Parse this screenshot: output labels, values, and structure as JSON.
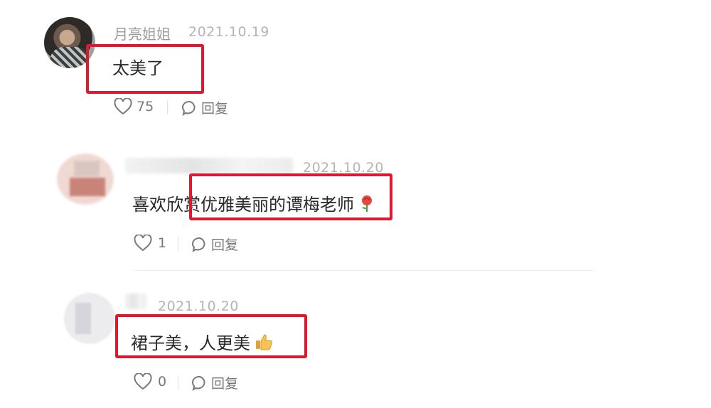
{
  "comments": [
    {
      "username": "月亮姐姐",
      "date": "2021.10.19",
      "text": "太美了",
      "likes": "75",
      "reply_label": "回复"
    },
    {
      "username": "",
      "date": "2021.10.20",
      "text": "喜欢欣赏优雅美丽的谭梅老师",
      "likes": "1",
      "reply_label": "回复",
      "emoji": "rose-emoji"
    },
    {
      "username": "",
      "date": "2021.10.20",
      "text": "裙子美，人更美",
      "likes": "0",
      "reply_label": "回复",
      "emoji": "thumbs-up-emoji"
    }
  ],
  "colors": {
    "highlight": "#e0182d",
    "meta_text": "#9a9a9a",
    "comment_text": "#2a2a2a"
  }
}
